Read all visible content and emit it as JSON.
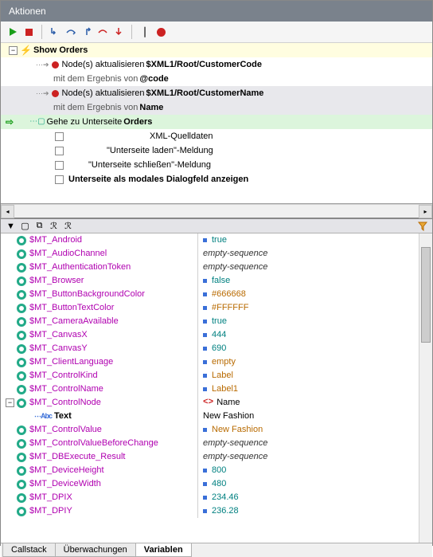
{
  "title": "Aktionen",
  "tree": {
    "root_label": "Show Orders",
    "action1": {
      "label": "Node(s) aktualisieren",
      "param": "$XML1/Root/CustomerCode",
      "sub_label": "mit dem Ergebnis von",
      "sub_param": "@code"
    },
    "action2": {
      "label": "Node(s) aktualisieren",
      "param": "$XML1/Root/CustomerName",
      "sub_label": "mit dem Ergebnis von",
      "sub_param": "Name"
    },
    "goto": {
      "label": "Gehe zu Unterseite",
      "param": "Orders"
    },
    "opts": {
      "o1": "XML-Quelldaten",
      "o2": "\"Unterseite laden\"-Meldung",
      "o3": "\"Unterseite schließen\"-Meldung",
      "o4": "Unterseite als modales Dialogfeld anzeigen"
    }
  },
  "vars": [
    {
      "name": "$MT_Android",
      "val": "true",
      "cls": "val-teal",
      "bullet": true
    },
    {
      "name": "$MT_AudioChannel",
      "val": "empty-sequence",
      "cls": "val-italic"
    },
    {
      "name": "$MT_AuthenticationToken",
      "val": "empty-sequence",
      "cls": "val-italic"
    },
    {
      "name": "$MT_Browser",
      "val": "false",
      "cls": "val-teal",
      "bullet": true
    },
    {
      "name": "$MT_ButtonBackgroundColor",
      "val": "#666668",
      "cls": "val-orange",
      "bullet": true
    },
    {
      "name": "$MT_ButtonTextColor",
      "val": "#FFFFFF",
      "cls": "val-orange",
      "bullet": true
    },
    {
      "name": "$MT_CameraAvailable",
      "val": "true",
      "cls": "val-teal",
      "bullet": true
    },
    {
      "name": "$MT_CanvasX",
      "val": "444",
      "cls": "val-teal",
      "bullet": true
    },
    {
      "name": "$MT_CanvasY",
      "val": "690",
      "cls": "val-teal",
      "bullet": true
    },
    {
      "name": "$MT_ClientLanguage",
      "val": "empty",
      "cls": "val-orange",
      "bullet": true
    },
    {
      "name": "$MT_ControlKind",
      "val": "Label",
      "cls": "val-orange",
      "bullet": true
    },
    {
      "name": "$MT_ControlName",
      "val": "Label1",
      "cls": "val-orange",
      "bullet": true
    },
    {
      "name": "$MT_ControlNode",
      "val": "Name",
      "cls": "val-black",
      "expandable": true,
      "tag": true
    },
    {
      "name": "Text",
      "val": "New Fashion",
      "cls": "val-black",
      "text_icon": true,
      "indent": 22
    },
    {
      "name": "$MT_ControlValue",
      "val": "New Fashion",
      "cls": "val-orange",
      "bullet": true
    },
    {
      "name": "$MT_ControlValueBeforeChange",
      "val": "empty-sequence",
      "cls": "val-italic"
    },
    {
      "name": "$MT_DBExecute_Result",
      "val": "empty-sequence",
      "cls": "val-italic"
    },
    {
      "name": "$MT_DeviceHeight",
      "val": "800",
      "cls": "val-teal",
      "bullet": true
    },
    {
      "name": "$MT_DeviceWidth",
      "val": "480",
      "cls": "val-teal",
      "bullet": true
    },
    {
      "name": "$MT_DPIX",
      "val": "234.46",
      "cls": "val-teal",
      "bullet": true
    },
    {
      "name": "$MT_DPIY",
      "val": "236.28",
      "cls": "val-teal",
      "bullet": true
    }
  ],
  "tabs": {
    "t1": "Callstack",
    "t2": "Überwachungen",
    "t3": "Variablen"
  }
}
